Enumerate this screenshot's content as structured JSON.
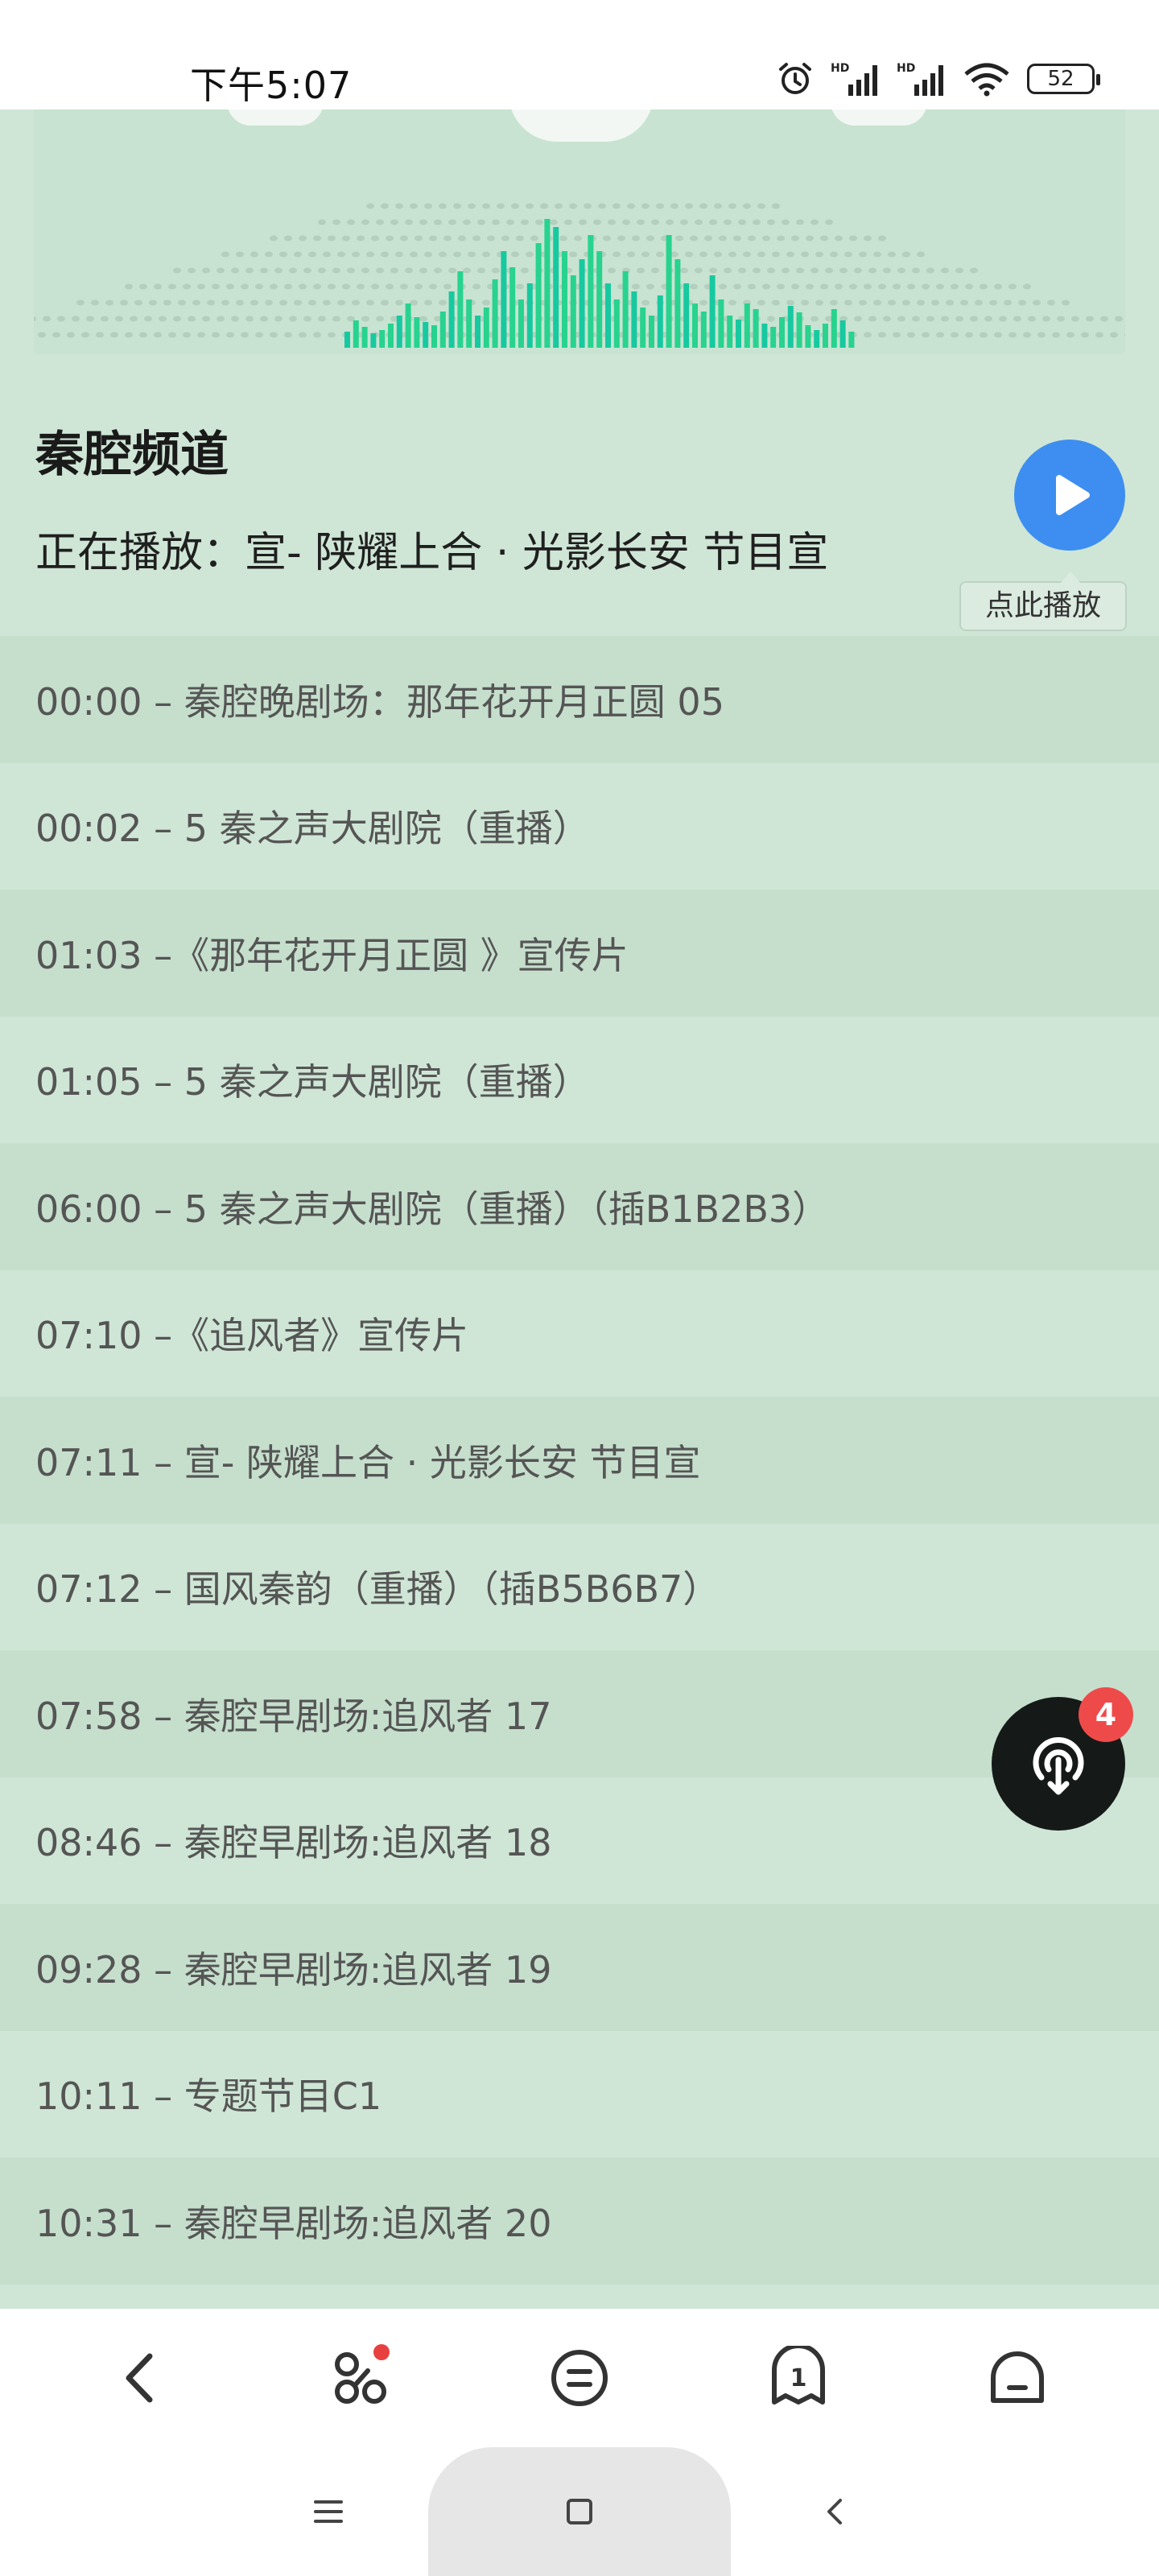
{
  "status_bar": {
    "time": "下午5:07",
    "battery": "52",
    "icons": [
      "alarm-icon",
      "signal-hd-icon",
      "signal-hd-icon",
      "wifi-icon",
      "battery-icon"
    ]
  },
  "channel": {
    "title": "秦腔频道",
    "now_playing": "正在播放：宣- 陕耀上合 · 光影长安 节目宣",
    "play_tip": "点此播放",
    "accent_color": "#3d8ef0"
  },
  "schedule": [
    {
      "text": "00:00 – 秦腔晚剧场：那年花开月正圆 05"
    },
    {
      "text": "00:02 – 5 秦之声大剧院（重播）"
    },
    {
      "text": "01:03 –《那年花开月正圆 》宣传片"
    },
    {
      "text": "01:05 – 5 秦之声大剧院（重播）"
    },
    {
      "text": "06:00 – 5 秦之声大剧院（重播）（插B1B2B3）"
    },
    {
      "text": "07:10 –《追风者》宣传片"
    },
    {
      "text": "07:11 – 宣- 陕耀上合 · 光影长安 节目宣"
    },
    {
      "text": "07:12 – 国风秦韵（重播）（插B5B6B7）"
    },
    {
      "text": "07:58 – 秦腔早剧场:追风者 17"
    },
    {
      "text": "08:46 – 秦腔早剧场:追风者 18"
    },
    {
      "text": "09:28 – 秦腔早剧场:追风者 19"
    },
    {
      "text": "10:11 – 专题节目C1"
    },
    {
      "text": "10:31 – 秦腔早剧场:追风者 20"
    }
  ],
  "download": {
    "badge_count": "4",
    "icon": "download-icon"
  },
  "toolbar": {
    "items": [
      "back-icon",
      "apps-icon",
      "menu-icon",
      "tab-count-icon",
      "home-icon"
    ],
    "tab_count": "1"
  },
  "nav_bar": {
    "items": [
      "recents-icon",
      "home-square-icon",
      "back-chevron-icon"
    ]
  }
}
